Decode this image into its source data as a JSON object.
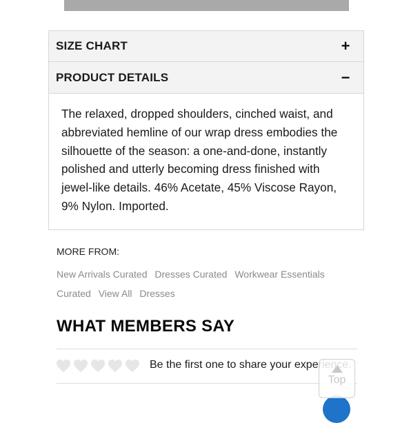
{
  "accordion": {
    "size_chart": {
      "title": "SIZE CHART",
      "sign": "+"
    },
    "product_details": {
      "title": "PRODUCT DETAILS",
      "sign": "−",
      "body": "The relaxed, dropped shoulders, cinched waist, and abbreviated hemline of our wrap dress embodies the silhouette of the season: a one-and-done, instantly polished and utterly becoming dress finished with jewel-like details. 46% Acetate, 45% Viscose Rayon, 9% Nylon. Imported."
    }
  },
  "more_from": {
    "label": "MORE FROM:",
    "links": [
      "New Arrivals Curated",
      "Dresses Curated",
      "Workwear Essentials Curated",
      "View All",
      "Dresses"
    ]
  },
  "reviews": {
    "title": "WHAT MEMBERS SAY",
    "rating_icon": "heart-icon",
    "rating_count": 5,
    "prompt": "Be the first one to share your experience."
  },
  "back_to_top": {
    "label": "Top",
    "icon": "up-arrow-icon"
  },
  "colors": {
    "heart": "#e6e6e6",
    "header_bg": "#f3f3f3",
    "link": "#8a8a8a",
    "accent_blue": "#1f73c9"
  }
}
